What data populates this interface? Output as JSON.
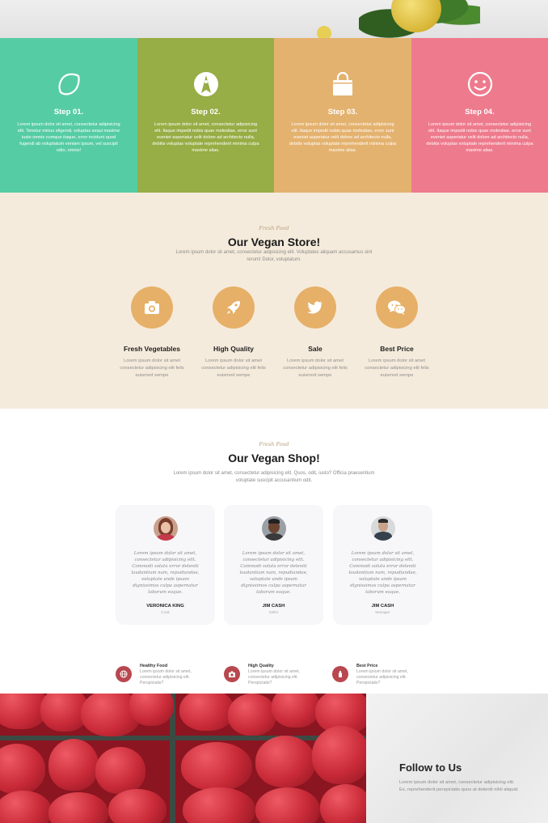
{
  "colors": {
    "step1": "#56cca4",
    "step2": "#97ad45",
    "step3": "#e4b26f",
    "step4": "#ee7a8d",
    "store_bg": "#f5ebdc",
    "accent_circle": "#e6b068",
    "mini_icon": "#b8474f"
  },
  "steps": [
    {
      "icon": "lemon-icon",
      "title": "Step 01.",
      "text": "Lorem ipsum dolor sit amet, consectetur adipisicing elit. Tenetur minus eligendi, voluptas sequi maxime iusto omnis cumque itaque, error incidunt quod fugendi ab voluptatum veniam ipsum, vel suscipit odio, omnis!"
    },
    {
      "icon": "pizza-icon",
      "title": "Step 02.",
      "text": "Lorem ipsum dolor sit amet, consectetur adipisicing elit. Itaque impedit nobis quae molestiae, error sunt eveniet asperiatur velit dolore ad architecto nulla, debitis voluptas voluptate reprehenderit minima culpa maxime alias."
    },
    {
      "icon": "shopping-bag-icon",
      "title": "Step 03.",
      "text": "Lorem ipsum dolor sit amet, consectetur adipisicing elit. Itaque impedit nobis quae molestiae, error sunt eveniet asperiatur velit dolore ad architecto nulla, debitis voluptas voluptate reprehenderit minima culpa maxime alias."
    },
    {
      "icon": "smiley-icon",
      "title": "Step 04.",
      "text": "Lorem ipsum dolor sit amet, consectetur adipisicing elit. Itaque impedit nobis quae molestiae, error sunt eveniet asperiatur velit dolore ad architecto nulla, debitis voluptas voluptate reprehenderit minima culpa maxime alias."
    }
  ],
  "store": {
    "tag": "Fresh Food",
    "title": "Our Vegan Store!",
    "subtitle": "Lorem ipsum dolor sit amet, consectetur adipisicing elit. Voluptates aliquam accusamus sint rerum! Dolor, voluptatum.",
    "features": [
      {
        "icon": "camera-icon",
        "name": "Fresh Vegetables",
        "desc": "Lorem ipsum dolor sit amet consectetur adipisicing elit felis euismod sempe"
      },
      {
        "icon": "rocket-icon",
        "name": "High Quality",
        "desc": "Lorem ipsum dolor sit amet consectetur adipisicing elit felis euismod sempe"
      },
      {
        "icon": "twitter-icon",
        "name": "Sale",
        "desc": "Lorem ipsum dolor sit amet consectetur adipisicing elit felis euismod sempe"
      },
      {
        "icon": "wechat-icon",
        "name": "Best Price",
        "desc": "Lorem ipsum dolor sit amet consectetur adipisicing elit felis euismod sempe"
      }
    ]
  },
  "shop": {
    "tag": "Fresh Food",
    "title": "Our Vegan Shop!",
    "subtitle": "Lorem ipsum dolor sit amet, consectetur adipisicing elit. Quos, odit, iusto? Officia praesentium voluptate suscipit accusantium odit.",
    "testimonials": [
      {
        "quote": "Lorem ipsum dolor sit amet, consectetur adipisicing elit. Commodi soluta error deleniti laudantium nam, repudiandae, voluptate unde ipsam dignissimos culpa aspernatur laborum eaque.",
        "name": "VERONICA KING",
        "role": "Cook"
      },
      {
        "quote": "Lorem ipsum dolor sit amet, consectetur adipisicing elit. Commodi soluta error deleniti laudantium nam, repudiandae, voluptate unde ipsam dignissimos culpa aspernatur laborum eaque.",
        "name": "JIM CASH",
        "role": "Seller"
      },
      {
        "quote": "Lorem ipsum dolor sit amet, consectetur adipisicing elit. Commodi soluta error deleniti laudantium nam, repudiandae, voluptate unde ipsam dignissimos culpa aspernatur laborum eaque.",
        "name": "JIM CASH",
        "role": "Manager"
      }
    ],
    "mini_features": [
      {
        "icon": "globe-icon",
        "title": "Healthy Food",
        "desc": "Lorem ipsum dolor sit amet, consectetur adipisicing elit. Perspiciatis?"
      },
      {
        "icon": "camera-icon",
        "title": "High Quality",
        "desc": "Lorem ipsum dolor sit amet, consectetur adipisicing elit. Perspiciatis?"
      },
      {
        "icon": "bottle-icon",
        "title": "Best Price",
        "desc": "Lorem ipsum dolor sit amet, consectetur adipisicing elit. Perspiciatis?"
      }
    ]
  },
  "follow": {
    "title": "Follow to Us",
    "desc": "Lorem ipsum dolor sit amet, consectetur adipisicing elit. Ex, reprehenderit perspiciatis quos at deleniti nihil aliquid."
  }
}
